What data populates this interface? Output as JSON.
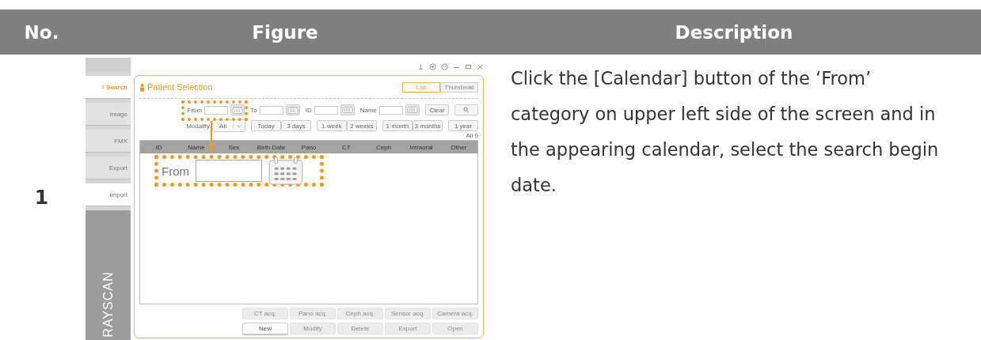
{
  "table": {
    "columns": [
      "No.",
      "Figure",
      "Description"
    ],
    "rows": [
      {
        "no": "1",
        "description": "Click the [Calendar] button of the ‘From’ category on upper left side of the screen and in the appearing calendar, select the search begin date.",
        "figure": {
          "sidebar": [
            {
              "label": "Search",
              "selected": true,
              "disabled": false
            },
            {
              "label": "Image",
              "selected": false,
              "disabled": true
            },
            {
              "label": "FMX",
              "selected": false,
              "disabled": true
            },
            {
              "label": "Export",
              "selected": false,
              "disabled": true
            },
            {
              "label": "Import",
              "selected": false,
              "disabled": false
            }
          ],
          "brand": "RAYSCAN",
          "panel_title": "Patient Selection",
          "view_tabs": [
            {
              "label": "List",
              "selected": true
            },
            {
              "label": "Thumbnail",
              "selected": false
            }
          ],
          "search_fields": [
            {
              "label": "From",
              "kind": "date"
            },
            {
              "label": "To",
              "kind": "date"
            },
            {
              "label": "ID",
              "kind": "text"
            },
            {
              "label": "Name",
              "kind": "text"
            }
          ],
          "clear_button": "Clear",
          "modality": {
            "label": "Modality",
            "value": "All"
          },
          "range_groups": [
            [
              "Today",
              "3 days"
            ],
            [
              "1 week",
              "2 weeks"
            ],
            [
              "1 month",
              "3 months"
            ],
            [
              "1 year"
            ]
          ],
          "count": "All 0",
          "list_columns": [
            "ID",
            "Name",
            "Sex",
            "Birth Date",
            "Pano",
            "CT",
            "Ceph",
            "Intraoral",
            "Other"
          ],
          "acquisition_buttons": [
            {
              "label": "CT acq.",
              "disabled": true
            },
            {
              "label": "Pano acq.",
              "disabled": true
            },
            {
              "label": "Ceph acq.",
              "disabled": true
            },
            {
              "label": "Sensor acq.",
              "disabled": true
            },
            {
              "label": "Camera acq.",
              "disabled": true
            }
          ],
          "action_buttons": [
            {
              "label": "New",
              "disabled": false
            },
            {
              "label": "Modify",
              "disabled": true
            },
            {
              "label": "Delete",
              "disabled": true
            },
            {
              "label": "Export",
              "disabled": true
            },
            {
              "label": "Open",
              "disabled": true
            }
          ],
          "callout": {
            "label": "From"
          }
        }
      }
    ]
  }
}
